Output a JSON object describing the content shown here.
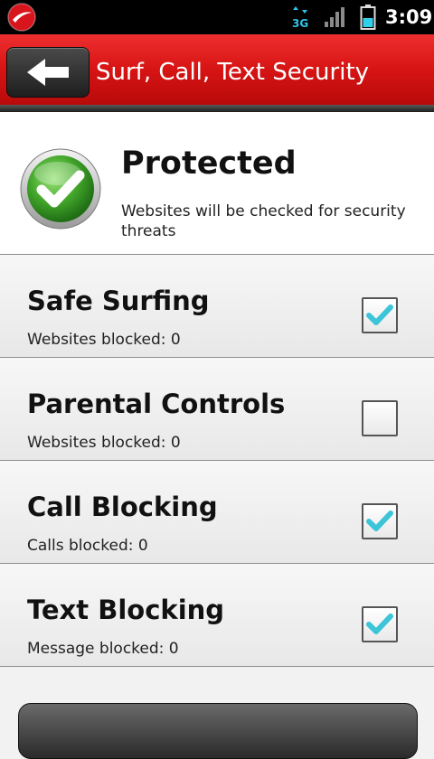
{
  "status_bar": {
    "time": "3:09",
    "network": "3G",
    "icons": [
      "trend-micro-logo-icon",
      "3g-data-icon",
      "signal-strength-icon",
      "battery-icon"
    ]
  },
  "header": {
    "title": "Surf, Call, Text Security",
    "back_icon": "arrow-left-icon",
    "accent_color": "#d71414"
  },
  "status": {
    "title": "Protected",
    "description": "Websites will be checked for security threats",
    "icon": "green-check-icon"
  },
  "features": [
    {
      "title": "Safe Surfing",
      "subtitle": "Websites blocked: 0",
      "checked": true
    },
    {
      "title": "Parental Controls",
      "subtitle": "Websites blocked: 0",
      "checked": false
    },
    {
      "title": "Call Blocking",
      "subtitle": "Calls blocked: 0",
      "checked": true
    },
    {
      "title": "Text Blocking",
      "subtitle": "Message blocked: 0",
      "checked": true
    }
  ],
  "colors": {
    "check_color": "#3cc4d8",
    "protected_green": "#3aa02a"
  }
}
